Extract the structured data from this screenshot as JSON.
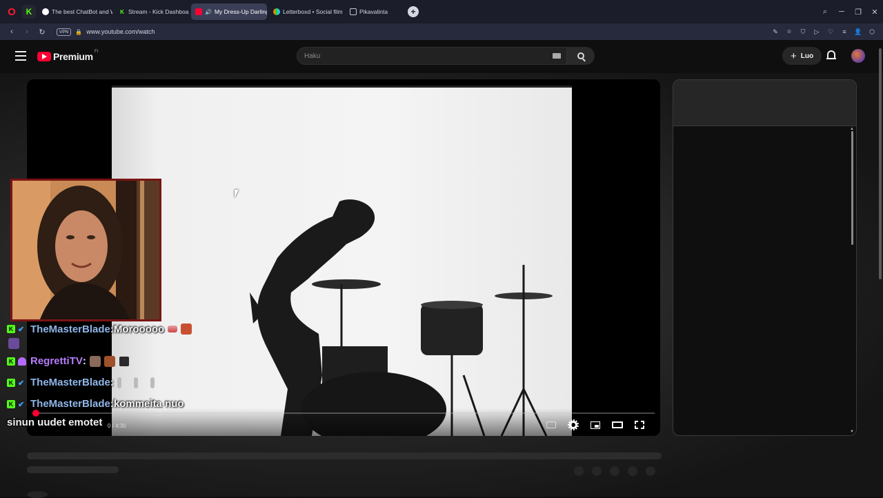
{
  "browser": {
    "tabs": [
      {
        "label": "The best ChatBot and Wid",
        "active": false,
        "fav_color": "#ffffff"
      },
      {
        "label": "Stream - Kick Dashboard",
        "active": false,
        "fav_color": "#53fc18"
      },
      {
        "label": "My Dress-Up Darling",
        "active": true,
        "fav_color": "#ff0033"
      },
      {
        "label": "Letterboxd • Social film d",
        "active": false,
        "fav_color": "#40bcf4"
      },
      {
        "label": "Pikavalinta",
        "active": false,
        "fav_color": "#c8cad6"
      }
    ],
    "url": "www.youtube.com/watch",
    "vpn_label": "VPN"
  },
  "youtube": {
    "logo_text": "Premium",
    "country_code": "FI",
    "search_placeholder": "Haku",
    "create_label": "Luo"
  },
  "player": {
    "time_display": "0 / 4:30",
    "progress_fraction": 0.006
  },
  "chat": {
    "messages": [
      {
        "user": "TheMasterBlade",
        "sep": " : ",
        "text": "Morooooo",
        "badge": "check",
        "user_color": "#8fb6e8"
      },
      {
        "user": "RegrettiTV",
        "sep": " : ",
        "text": "",
        "badge": "mic",
        "user_color": "#b67dff"
      },
      {
        "user": "TheMasterBlade",
        "sep": " : ",
        "text": "",
        "badge": "check",
        "user_color": "#8fb6e8"
      },
      {
        "user": "TheMasterBlade",
        "sep": " : ",
        "text": "kommeita nuo",
        "badge": "check",
        "user_color": "#8fb6e8"
      }
    ],
    "continuation": "sinun uudet emotet"
  },
  "colors": {
    "accent": "#ff0033",
    "kick_green": "#53fc18",
    "webcam_border": "#7a1414"
  }
}
